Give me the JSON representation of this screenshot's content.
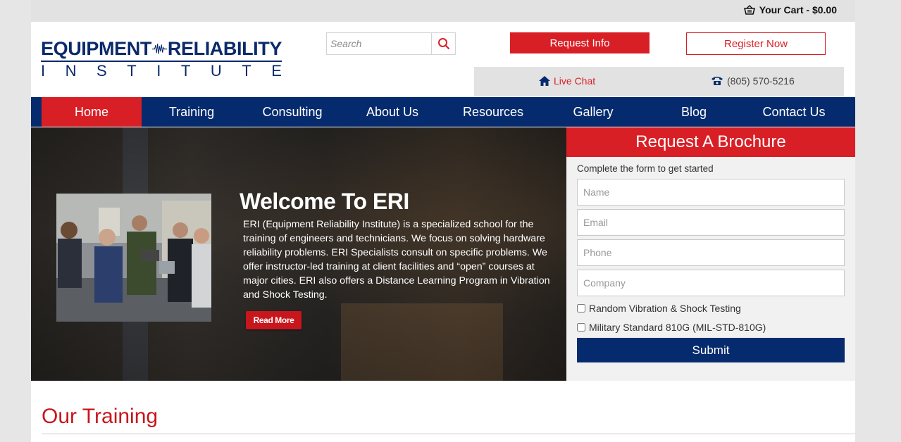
{
  "topbar": {
    "cart_label": "Your Cart - $0.00",
    "cart_icon": "basket-icon"
  },
  "logo": {
    "line1_left": "EQUIPMENT",
    "line1_right": "RELIABILITY",
    "line2": [
      "I",
      "N",
      "S",
      "T",
      "I",
      "T",
      "U",
      "T",
      "E"
    ]
  },
  "search": {
    "placeholder": "Search",
    "icon": "search-icon"
  },
  "header_buttons": {
    "request_info": "Request Info",
    "register_now": "Register Now"
  },
  "contact": {
    "live_chat": "Live Chat",
    "phone": "(805) 570-5216"
  },
  "nav": {
    "items": [
      {
        "label": "Home",
        "active": true
      },
      {
        "label": "Training"
      },
      {
        "label": "Consulting"
      },
      {
        "label": "About Us"
      },
      {
        "label": "Resources"
      },
      {
        "label": "Gallery"
      },
      {
        "label": "Blog"
      },
      {
        "label": "Contact Us"
      }
    ]
  },
  "hero": {
    "title": "Welcome To ERI",
    "body": "ERI (Equipment Reliability Institute) is a specialized school for the training of engineers and technicians. We focus on solving hardware reliability problems. ERI Specialists consult on specific problems. We offer instructor-led training at client facilities and “open” courses at major cities. ERI also offers a Distance Learning Program in Vibration and Shock Testing.",
    "read_more": "Read More"
  },
  "brochure_form": {
    "title": "Request A Brochure",
    "subtitle": "Complete the form to get started",
    "fields": {
      "name": "Name",
      "email": "Email",
      "phone": "Phone",
      "company": "Company"
    },
    "checkboxes": [
      {
        "label": "Random Vibration & Shock Testing",
        "checked": false
      },
      {
        "label": "Military Standard 810G (MIL-STD-810G)",
        "checked": false
      }
    ],
    "submit": "Submit"
  },
  "section": {
    "title": "Our Training"
  },
  "colors": {
    "brand_red": "#d91f26",
    "brand_navy": "#052b6e"
  }
}
